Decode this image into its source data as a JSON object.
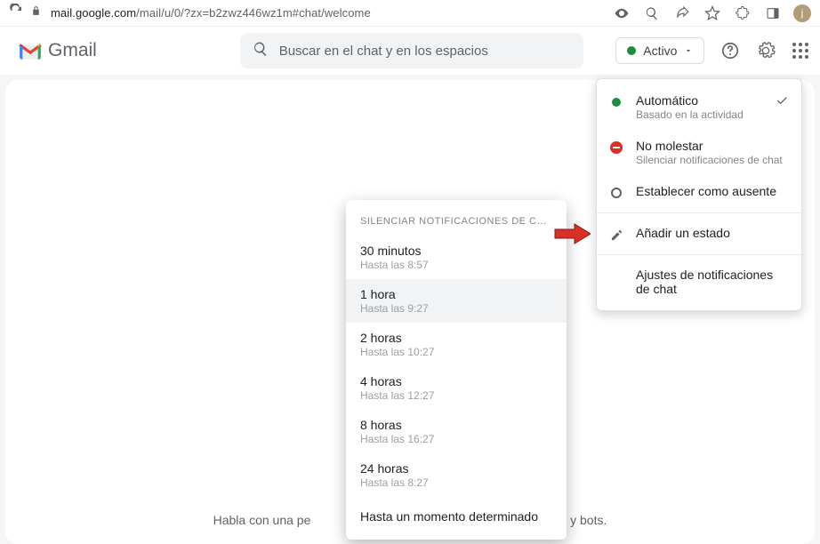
{
  "omnibox": {
    "host": "mail.google.com",
    "path": "/mail/u/0/?zx=b2zwz446wz1m#chat/welcome",
    "avatar_initial": "j"
  },
  "header": {
    "brand": "Gmail",
    "search_placeholder": "Buscar en el chat y en los espacios",
    "status_label": "Activo"
  },
  "dropdown": {
    "auto": {
      "title": "Automático",
      "sub": "Basado en la actividad"
    },
    "dnd": {
      "title": "No molestar",
      "sub": "Silenciar notificaciones de chat"
    },
    "away": {
      "title": "Establecer como ausente"
    },
    "add_status": "Añadir un estado",
    "settings": "Ajustes de notificaciones de chat"
  },
  "submenu": {
    "header": "SILENCIAR NOTIFICACIONES DE CHAT D…",
    "items": [
      {
        "title": "30 minutos",
        "sub": "Hasta las 8:57",
        "hovered": false
      },
      {
        "title": "1 hora",
        "sub": "Hasta las 9:27",
        "hovered": true
      },
      {
        "title": "2 horas",
        "sub": "Hasta las 10:27",
        "hovered": false
      },
      {
        "title": "4 horas",
        "sub": "Hasta las 12:27",
        "hovered": false
      },
      {
        "title": "8 horas",
        "sub": "Hasta las 16:27",
        "hovered": false
      },
      {
        "title": "24 horas",
        "sub": "Hasta las 8:27",
        "hovered": false
      }
    ],
    "custom": "Hasta un momento determinado"
  },
  "bg": {
    "left": "Habla con una pe",
    "right": " y bots."
  }
}
